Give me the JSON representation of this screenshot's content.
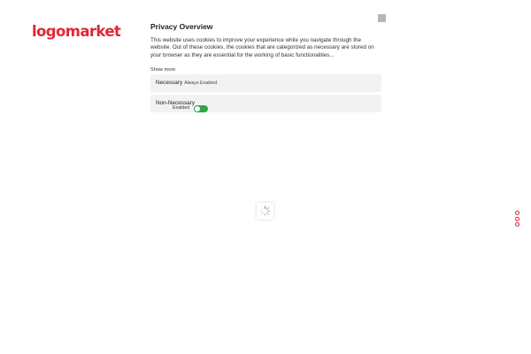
{
  "brand": {
    "logo_text": "logomarket",
    "accent_color": "#e32636"
  },
  "privacy": {
    "title": "Privacy Overview",
    "description": "This website uses cookies to improve your experience while you navigate through the website. Out of these cookies, the cookies that are categorized as necessary are stored on your browser as they are essential for the working of basic functionalities...",
    "show_more": "Show more"
  },
  "categories": [
    {
      "name": "Necessary",
      "status": "Always Enabled"
    },
    {
      "name": "Non-Necessary",
      "toggle_label": "Enabled",
      "toggle_on": true,
      "toggle_color": "#2ea84a"
    }
  ],
  "icons": {
    "close": "close-icon",
    "loader": "loading-spinner-icon",
    "side_nav": "circle-dot-icon"
  }
}
